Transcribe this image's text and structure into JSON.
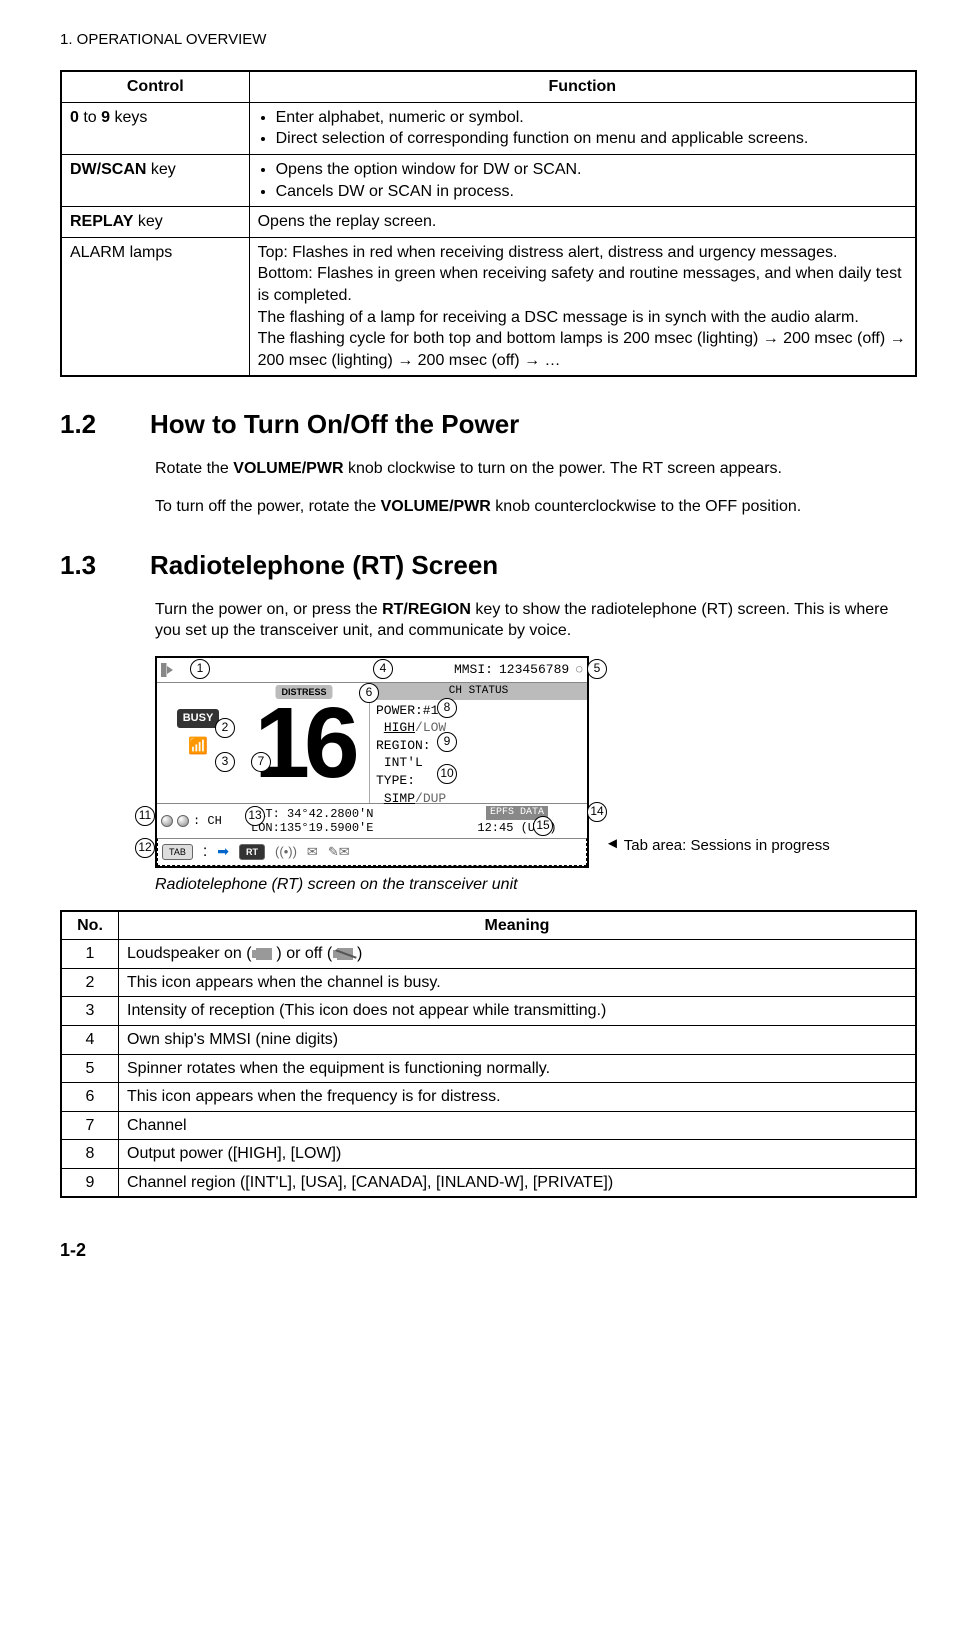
{
  "chapter_header": "1.  OPERATIONAL OVERVIEW",
  "controls_table": {
    "headers": {
      "control": "Control",
      "function": "Function"
    },
    "rows": [
      {
        "control_html": "<b>0</b> to <b>9</b> keys",
        "function_bullets": [
          "Enter alphabet, numeric or symbol.",
          "Direct selection of corresponding function on menu and applicable screens."
        ]
      },
      {
        "control_html": "<b>DW/SCAN</b> key",
        "function_bullets": [
          "Opens the option window for DW or SCAN.",
          "Cancels DW or SCAN in process."
        ]
      },
      {
        "control_html": "<b>REPLAY</b> key",
        "function_text": "Opens the replay screen."
      },
      {
        "control_html": "ALARM lamps",
        "function_text": "Top: Flashes in red when receiving distress alert, distress and urgency messages.\nBottom: Flashes in green when receiving safety and routine messages, and when daily test is completed.\nThe flashing of a lamp for receiving a DSC message is in synch with the audio alarm.\nThe flashing cycle for both top and bottom lamps is 200 msec (lighting) → 200 msec (off) → 200 msec (lighting) → 200 msec (off) → …"
      }
    ]
  },
  "section_1_2": {
    "num": "1.2",
    "title": "How to Turn On/Off the Power",
    "p1_pre": "Rotate the ",
    "p1_bold": "VOLUME/PWR",
    "p1_post": " knob clockwise to turn on the power. The RT screen appears.",
    "p2_pre": "To turn off the power, rotate the ",
    "p2_bold": "VOLUME/PWR",
    "p2_post": " knob counterclockwise to the OFF position."
  },
  "section_1_3": {
    "num": "1.3",
    "title": "Radiotelephone (RT) Screen",
    "p1_pre": "Turn the power on, or press the ",
    "p1_bold": "RT/REGION",
    "p1_post": " key to show the radiotelephone (RT) screen. This is where you set up the transceiver unit, and communicate by voice."
  },
  "rt_screen": {
    "mmsi_label": "MMSI:",
    "mmsi_value": "123456789",
    "busy": "BUSY",
    "distress": "DISTRESS",
    "channel": "16",
    "ch_status": "CH STATUS",
    "power_label": "POWER:#16",
    "power_high": "HIGH",
    "power_low": "/LOW",
    "region_label": "REGION:",
    "region_value": "INT'L",
    "type_label": "TYPE:",
    "type_simp": "SIMP",
    "type_dup": "/DUP",
    "ch_label": ": CH",
    "lat": "LAT: 34°42.2800'N",
    "lon": "LON:135°19.5900'E",
    "epfs": "EPFS DATA",
    "time": "12:45 (UTC)",
    "tab_label": "TAB",
    "tab_colon": ":",
    "tab_arrow": "➡",
    "rt_tab": "RT",
    "annotation": "Tab area: Sessions in progress",
    "caption": "Radiotelephone (RT) screen on the transceiver unit"
  },
  "meaning_table": {
    "headers": {
      "no": "No.",
      "meaning": "Meaning"
    },
    "rows": [
      {
        "no": "1",
        "meaning_html": "Loudspeaker on ( <span class=\"speaker-mini\"></span> ) or off ( <span class=\"speaker-mini off\"></span> )"
      },
      {
        "no": "2",
        "meaning": "This icon appears when the channel is busy."
      },
      {
        "no": "3",
        "meaning": "Intensity of reception (This icon does not appear while transmitting.)"
      },
      {
        "no": "4",
        "meaning": "Own ship's MMSI (nine digits)"
      },
      {
        "no": "5",
        "meaning": "Spinner rotates when the equipment is functioning normally."
      },
      {
        "no": "6",
        "meaning": "This icon appears when the frequency is for distress."
      },
      {
        "no": "7",
        "meaning": "Channel"
      },
      {
        "no": "8",
        "meaning": "Output power ([HIGH], [LOW])"
      },
      {
        "no": "9",
        "meaning": "Channel region ([INT'L], [USA], [CANADA], [INLAND-W], [PRIVATE])"
      }
    ]
  },
  "page_number": "1-2"
}
